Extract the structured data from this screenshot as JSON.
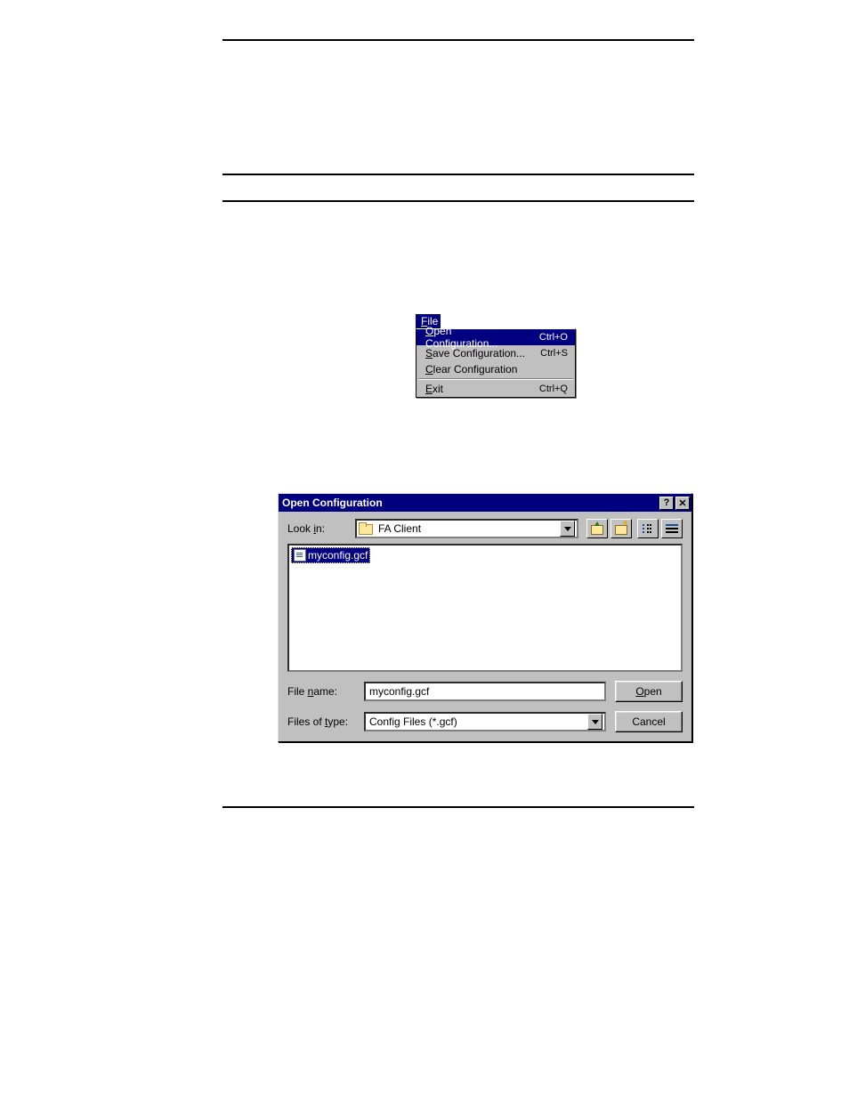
{
  "menu": {
    "file_label": "File",
    "items": [
      {
        "label": "Open Configuration...",
        "shortcut": "Ctrl+O",
        "selected": true
      },
      {
        "label": "Save Configuration...",
        "shortcut": "Ctrl+S",
        "selected": false
      },
      {
        "label": "Clear Configuration",
        "shortcut": "",
        "selected": false
      }
    ],
    "exit": {
      "label": "Exit",
      "shortcut": "Ctrl+Q"
    }
  },
  "dialog": {
    "title": "Open Configuration",
    "look_in_label": "Look in:",
    "look_in_value": "FA Client",
    "file_list": [
      {
        "name": "myconfig.gcf",
        "selected": true
      }
    ],
    "file_name_label": "File name:",
    "file_name_value": "myconfig.gcf",
    "files_of_type_label": "Files of type:",
    "files_of_type_value": "Config Files (*.gcf)",
    "open_label": "Open",
    "cancel_label": "Cancel"
  }
}
